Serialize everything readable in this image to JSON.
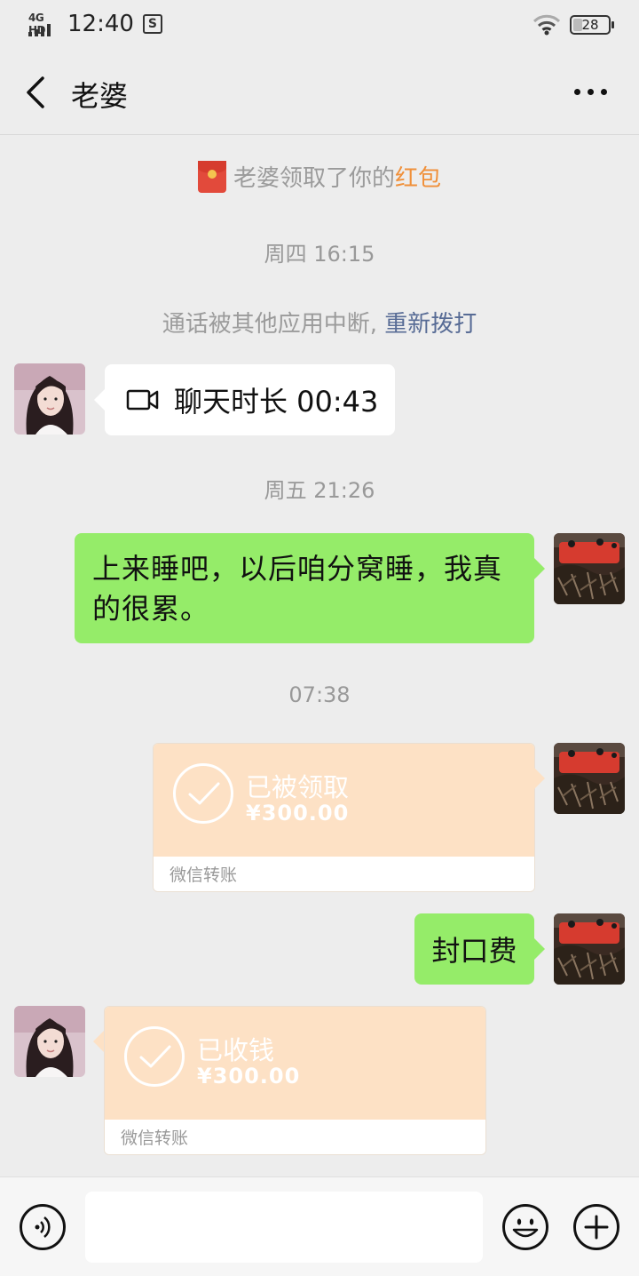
{
  "status_bar": {
    "network": "4G HD",
    "time": "12:40",
    "sim_icon": "S",
    "battery": "28"
  },
  "header": {
    "title": "老婆",
    "back_icon": "chevron-left-icon",
    "more_icon": "more-dots-icon"
  },
  "messages": {
    "red_packet_notice": {
      "text": "老婆领取了你的",
      "link": "红包"
    },
    "time_1": "周四 16:15",
    "call_notice": {
      "text": "通话被其他应用中断,",
      "action": "重新拨打"
    },
    "video_call": {
      "icon": "video-camera-icon",
      "text": "聊天时长 00:43"
    },
    "time_2": "周五 21:26",
    "text_msg_1": "上来睡吧，以后咱分窝睡，我真的很累。",
    "time_3": "07:38",
    "transfer_1": {
      "status": "已被领取",
      "amount": "¥300.00",
      "label": "微信转账"
    },
    "text_msg_2": "封口费",
    "transfer_2": {
      "status": "已收钱",
      "amount": "¥300.00",
      "label": "微信转账"
    }
  },
  "input_bar": {
    "voice_icon": "voice-icon",
    "placeholder": "",
    "emoji_icon": "emoji-icon",
    "plus_icon": "plus-icon"
  },
  "colors": {
    "background": "#ededed",
    "green_bubble": "#95ec69",
    "transfer_bg": "#fde1c5",
    "link_blue": "#576b95",
    "red_packet_orange": "#f0903a"
  }
}
